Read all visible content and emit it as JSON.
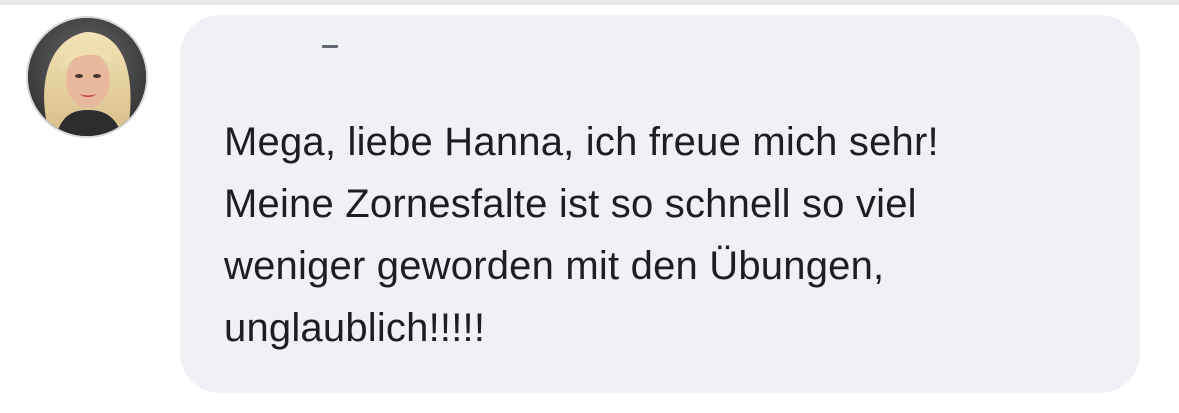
{
  "comment": {
    "avatar_icon": "user-avatar-photo",
    "author_name": "",
    "text": "Mega, liebe Hanna, ich freue mich sehr!\nMeine Zornesfalte ist so schnell so viel\nweniger geworden mit den Übungen,\nunglaublich!!!!!"
  },
  "colors": {
    "bubble_background": "#f0f1f5",
    "text": "#1c1e21",
    "page_background": "#ffffff"
  }
}
